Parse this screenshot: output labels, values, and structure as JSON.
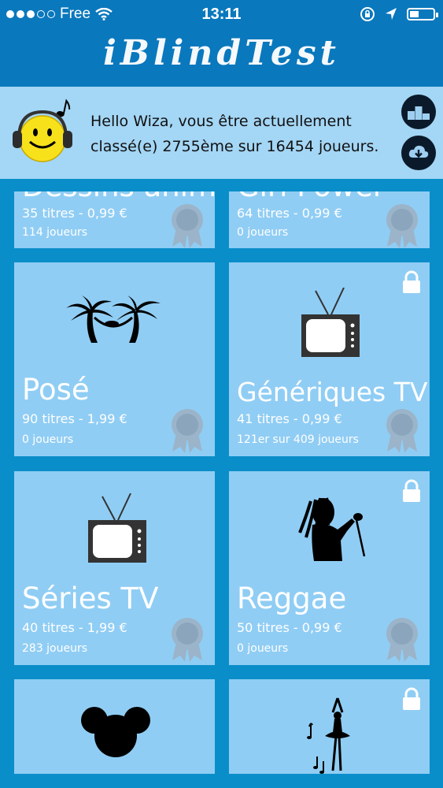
{
  "status_bar": {
    "carrier": "Free",
    "time": "13:11"
  },
  "app": {
    "title": "iBlindTest"
  },
  "banner": {
    "greeting": "Hello Wiza, vous être actuellement classé(e) 2755ème sur 16454 joueurs."
  },
  "icons": {
    "ranking": "podium-icon",
    "download": "cloud-download-icon",
    "lock": "lock-icon",
    "medal": "medal-icon"
  },
  "categories": [
    {
      "title": "Dessins animés",
      "meta": "35 titres - 0,99 €",
      "players": "114 joueurs",
      "locked": false
    },
    {
      "title": "Girl Power",
      "meta": "64 titres - 0,99 €",
      "players": "0 joueurs",
      "locked": false
    },
    {
      "title": "Posé",
      "meta": "90 titres - 1,99 €",
      "players": "0 joueurs",
      "locked": false
    },
    {
      "title": "Génériques TV",
      "meta": "41 titres - 0,99 €",
      "players": "121er sur 409 joueurs",
      "locked": true
    },
    {
      "title": "Séries TV",
      "meta": "40 titres - 1,99 €",
      "players": "283 joueurs",
      "locked": false
    },
    {
      "title": "Reggae",
      "meta": "50 titres - 0,99 €",
      "players": "0 joueurs",
      "locked": true
    },
    {
      "title": "",
      "meta": "",
      "players": "",
      "locked": false
    },
    {
      "title": "",
      "meta": "",
      "players": "",
      "locked": true
    }
  ],
  "colors": {
    "nav": "#0a78bd",
    "banner": "#a4d6f5",
    "tile": "#90cdf4",
    "background": "#0a8ec9"
  }
}
